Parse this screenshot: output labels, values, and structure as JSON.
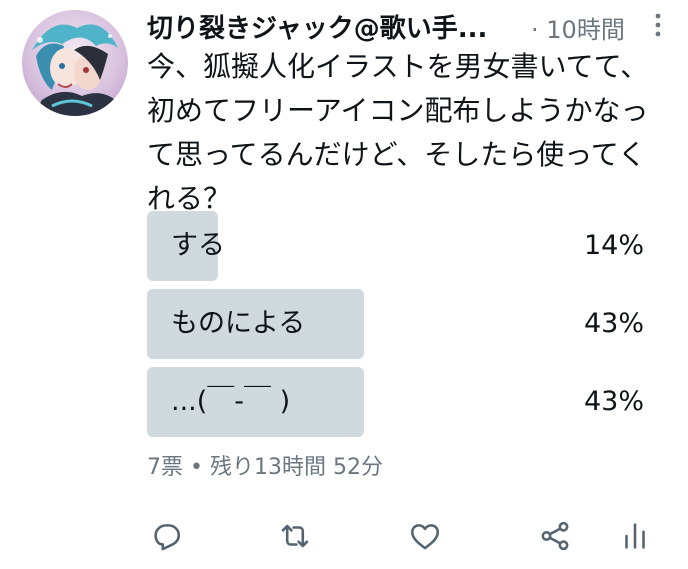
{
  "tweet": {
    "display_name": "切り裂きジャック@歌い手...",
    "separator": "·",
    "time": "10時間",
    "text": "今、狐擬人化イラストを男女書いてて、初めてフリーアイコン配布しようかなって思ってるんだけど、そしたら使ってくれる？"
  },
  "poll": {
    "options": [
      {
        "label": "する",
        "percent": "14%",
        "value": 14
      },
      {
        "label": "ものによる",
        "percent": "43%",
        "value": 43
      },
      {
        "label": "...(￣-￣ )",
        "percent": "43%",
        "value": 43
      }
    ],
    "votes": "7票",
    "bullet": "•",
    "remaining": "残り13時間 52分"
  },
  "icons": {
    "more": "more-vertical-icon",
    "reply": "reply-icon",
    "retweet": "retweet-icon",
    "like": "like-icon",
    "share": "share-icon",
    "analytics": "analytics-icon"
  },
  "colors": {
    "text": "#0f1419",
    "muted": "#6b7780",
    "poll_bar": "#cfd9de"
  }
}
